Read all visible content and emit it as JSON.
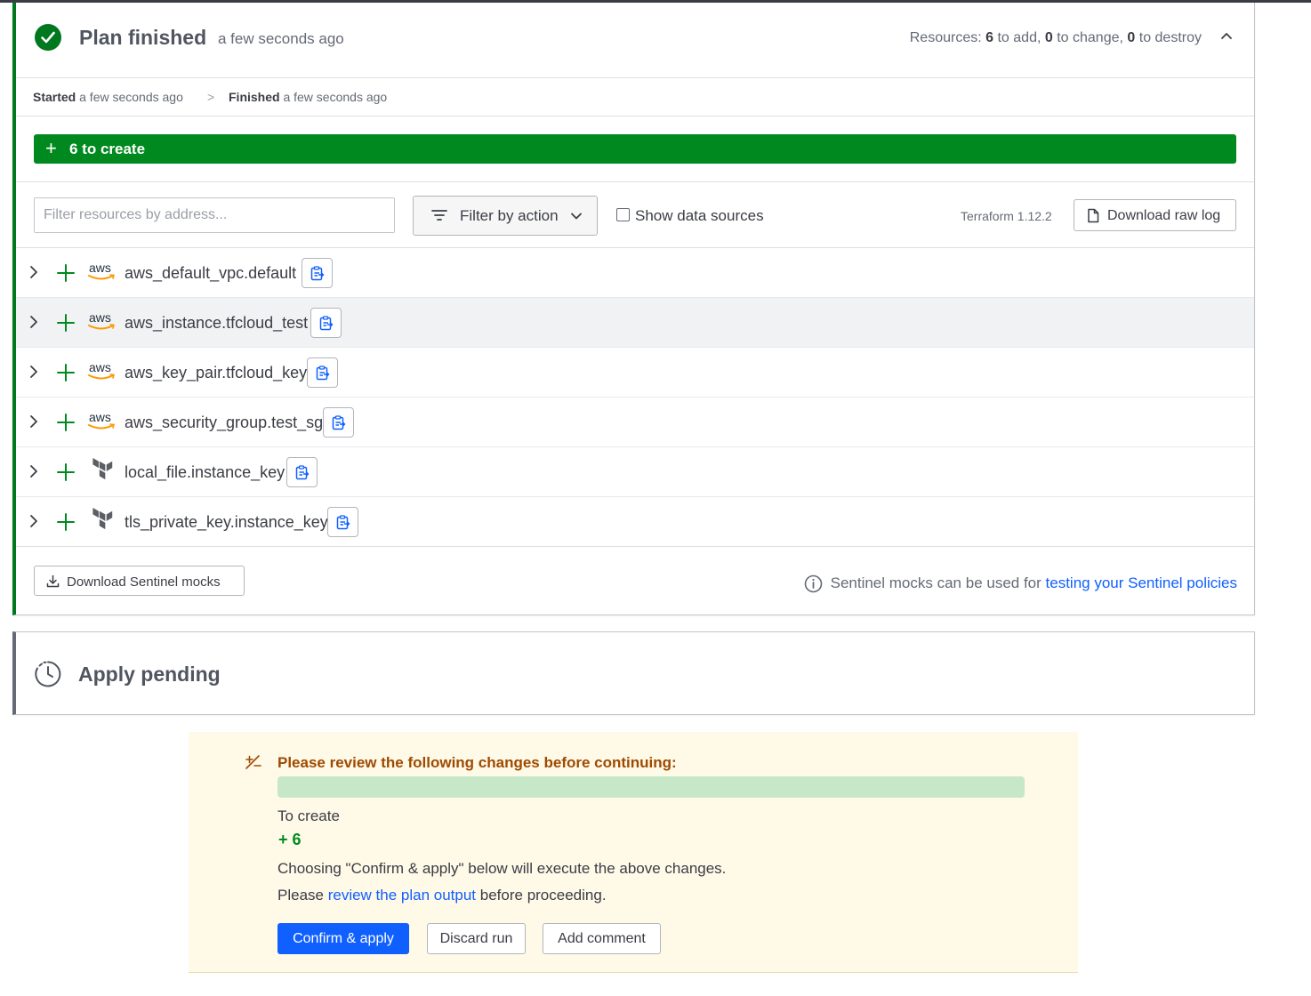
{
  "plan": {
    "title": "Plan finished",
    "ago": "a few seconds ago",
    "resources": {
      "prefix": "Resources: ",
      "add_count": "6",
      "add_text": " to add, ",
      "change_count": "0",
      "change_text": " to change, ",
      "destroy_count": "0",
      "destroy_text": " to destroy"
    },
    "timeline": {
      "started_label": "Started",
      "started_value": " a few seconds ago",
      "separator": ">",
      "finished_label": "Finished",
      "finished_value": " a few seconds ago"
    },
    "create_bar": {
      "plus": "+",
      "label": "6 to create"
    },
    "filters": {
      "address_placeholder": "Filter resources by address...",
      "filter_by_action": "Filter by action",
      "show_data_sources": "Show data sources",
      "terraform_version": "Terraform 1.12.2",
      "download_raw_log": "Download raw log"
    },
    "resources_list": [
      {
        "name": "aws_default_vpc.default",
        "provider": "aws"
      },
      {
        "name": "aws_instance.tfcloud_test",
        "provider": "aws"
      },
      {
        "name": "aws_key_pair.tfcloud_key",
        "provider": "aws"
      },
      {
        "name": "aws_security_group.test_sg",
        "provider": "aws"
      },
      {
        "name": "local_file.instance_key",
        "provider": "terraform"
      },
      {
        "name": "tls_private_key.instance_key",
        "provider": "terraform"
      }
    ],
    "provider_label_aws": "aws",
    "footer": {
      "download_sentinel_mocks": "Download Sentinel mocks",
      "sentinel_text": "Sentinel mocks can be used for ",
      "sentinel_link": "testing your Sentinel policies"
    }
  },
  "apply": {
    "title": "Apply pending"
  },
  "review": {
    "heading": "Please review the following changes before continuing:",
    "to_create_label": "To create",
    "to_create_count": "+ 6",
    "line1": "Choosing \"Confirm & apply\" below will execute the above changes.",
    "line2_prefix": "Please ",
    "line2_link": "review the plan output",
    "line2_suffix": " before proceeding.",
    "confirm_button": "Confirm & apply",
    "discard_button": "Discard run",
    "comment_button": "Add comment"
  },
  "colors": {
    "success_green": "#00781e",
    "create_bar_green": "#00891e",
    "link_blue": "#1060ff",
    "warning_bg": "#fff9e8",
    "warning_text": "#9e4b00"
  },
  "icons": [
    "check-circle-icon",
    "chevron-up-icon",
    "plus-icon",
    "filter-lines-icon",
    "chevron-down-icon",
    "document-icon",
    "chevron-right-icon",
    "aws-logo-icon",
    "terraform-logo-icon",
    "clipboard-copy-icon",
    "download-icon",
    "info-icon",
    "clock-icon",
    "diff-icon"
  ]
}
